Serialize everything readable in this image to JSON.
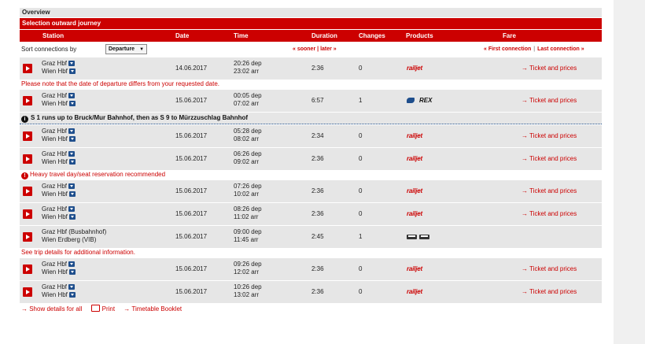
{
  "overview": "Overview",
  "journey_title": "Selection outward journey",
  "headers": {
    "station": "Station",
    "date": "Date",
    "time": "Time",
    "duration": "Duration",
    "changes": "Changes",
    "products": "Products",
    "fare": "Fare"
  },
  "sort": {
    "label": "Sort connections by",
    "selected": "Departure",
    "sooner": "« sooner",
    "later": "later »",
    "separator": "|",
    "first": "« First connection",
    "last": "Last connection »"
  },
  "connections": [
    {
      "from": "Graz Hbf",
      "to": "Wien Hbf",
      "date": "14.06.2017",
      "dep": "20:26 dep",
      "arr": "23:02 arr",
      "duration": "2:36",
      "changes": "0",
      "product": "railjet",
      "ticket": "→ Ticket and prices"
    },
    {
      "from": "Graz Hbf",
      "to": "Wien Hbf",
      "date": "15.06.2017",
      "dep": "00:05 dep",
      "arr": "07:02 arr",
      "duration": "6:57",
      "changes": "1",
      "product": "REX",
      "ticket": "→ Ticket and prices"
    },
    {
      "from": "Graz Hbf",
      "to": "Wien Hbf",
      "date": "15.06.2017",
      "dep": "05:28 dep",
      "arr": "08:02 arr",
      "duration": "2:34",
      "changes": "0",
      "product": "railjet",
      "ticket": "→ Ticket and prices"
    },
    {
      "from": "Graz Hbf",
      "to": "Wien Hbf",
      "date": "15.06.2017",
      "dep": "06:26 dep",
      "arr": "09:02 arr",
      "duration": "2:36",
      "changes": "0",
      "product": "railjet",
      "ticket": "→ Ticket and prices"
    },
    {
      "from": "Graz Hbf",
      "to": "Wien Hbf",
      "date": "15.06.2017",
      "dep": "07:26 dep",
      "arr": "10:02 arr",
      "duration": "2:36",
      "changes": "0",
      "product": "railjet",
      "ticket": "→ Ticket and prices"
    },
    {
      "from": "Graz Hbf",
      "to": "Wien Hbf",
      "date": "15.06.2017",
      "dep": "08:26 dep",
      "arr": "11:02 arr",
      "duration": "2:36",
      "changes": "0",
      "product": "railjet",
      "ticket": "→ Ticket and prices"
    },
    {
      "from": "Graz Hbf (Busbahnhof)",
      "to": "Wien Erdberg (VIB)",
      "date": "15.06.2017",
      "dep": "09:00 dep",
      "arr": "11:45 arr",
      "duration": "2:45",
      "changes": "1",
      "product": "bus"
    },
    {
      "from": "Graz Hbf",
      "to": "Wien Hbf",
      "date": "15.06.2017",
      "dep": "09:26 dep",
      "arr": "12:02 arr",
      "duration": "2:36",
      "changes": "0",
      "product": "railjet",
      "ticket": "→ Ticket and prices"
    },
    {
      "from": "Graz Hbf",
      "to": "Wien Hbf",
      "date": "15.06.2017",
      "dep": "10:26 dep",
      "arr": "13:02 arr",
      "duration": "2:36",
      "changes": "0",
      "product": "railjet",
      "ticket": "→ Ticket and prices"
    }
  ],
  "notes": {
    "date_differs": "Please note that the date of departure differs from your requested date.",
    "s1_info": "S 1 runs up to Bruck/Mur Bahnhof, then as S 9 to Mürzzuschlag Bahnhof",
    "heavy_travel": "Heavy travel day/seat reservation recommended",
    "see_trip": "See trip details for additional information."
  },
  "footer": {
    "show_details": "→ Show details for all",
    "print": "Print",
    "timetable": "→ Timetable Booklet"
  },
  "colors": {
    "brand_red": "#cc0000",
    "row_grey": "#e6e6e6",
    "info_blue": "#1e4e8c"
  }
}
